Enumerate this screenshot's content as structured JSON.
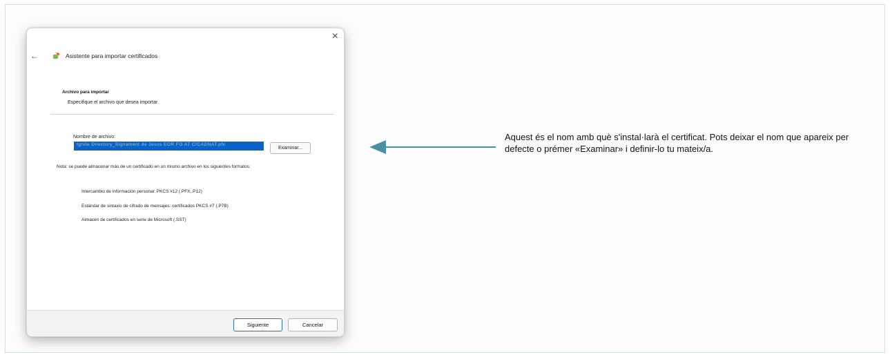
{
  "dialog": {
    "title": "Asistente para importar certificados",
    "close_glyph": "×",
    "back_glyph": "←",
    "section_title": "Archivo para importar",
    "section_subtitle": "Especifique el archivo que desea importar.",
    "filename_label": "Nombre de archivo:",
    "filename_value": "Ignite Directory_Signament de Jesus EOR FO AT C/CADNAT.pfx",
    "browse_label": "Examinar...",
    "note": "Nota: se puede almacenar más de un certificado en un mismo archivo en los siguientes formatos:",
    "formats": [
      "Intercambio de información personal: PKCS #12 (.PFX,.P12)",
      "Estándar de sintaxis de cifrado de mensajes: certificados PKCS #7 (.P7B)",
      "Almacén de certificados en serie de Microsoft (.SST)"
    ],
    "next_label": "Siguiente",
    "cancel_label": "Cancelar"
  },
  "annotation": {
    "text": "Aquest és el nom amb què s'instal·larà el certificat. Pots deixar el nom que apareix per defecte o prémer «Examinar» i definir-lo tu mateix/a.",
    "arrow_color": "#4a90a4"
  }
}
